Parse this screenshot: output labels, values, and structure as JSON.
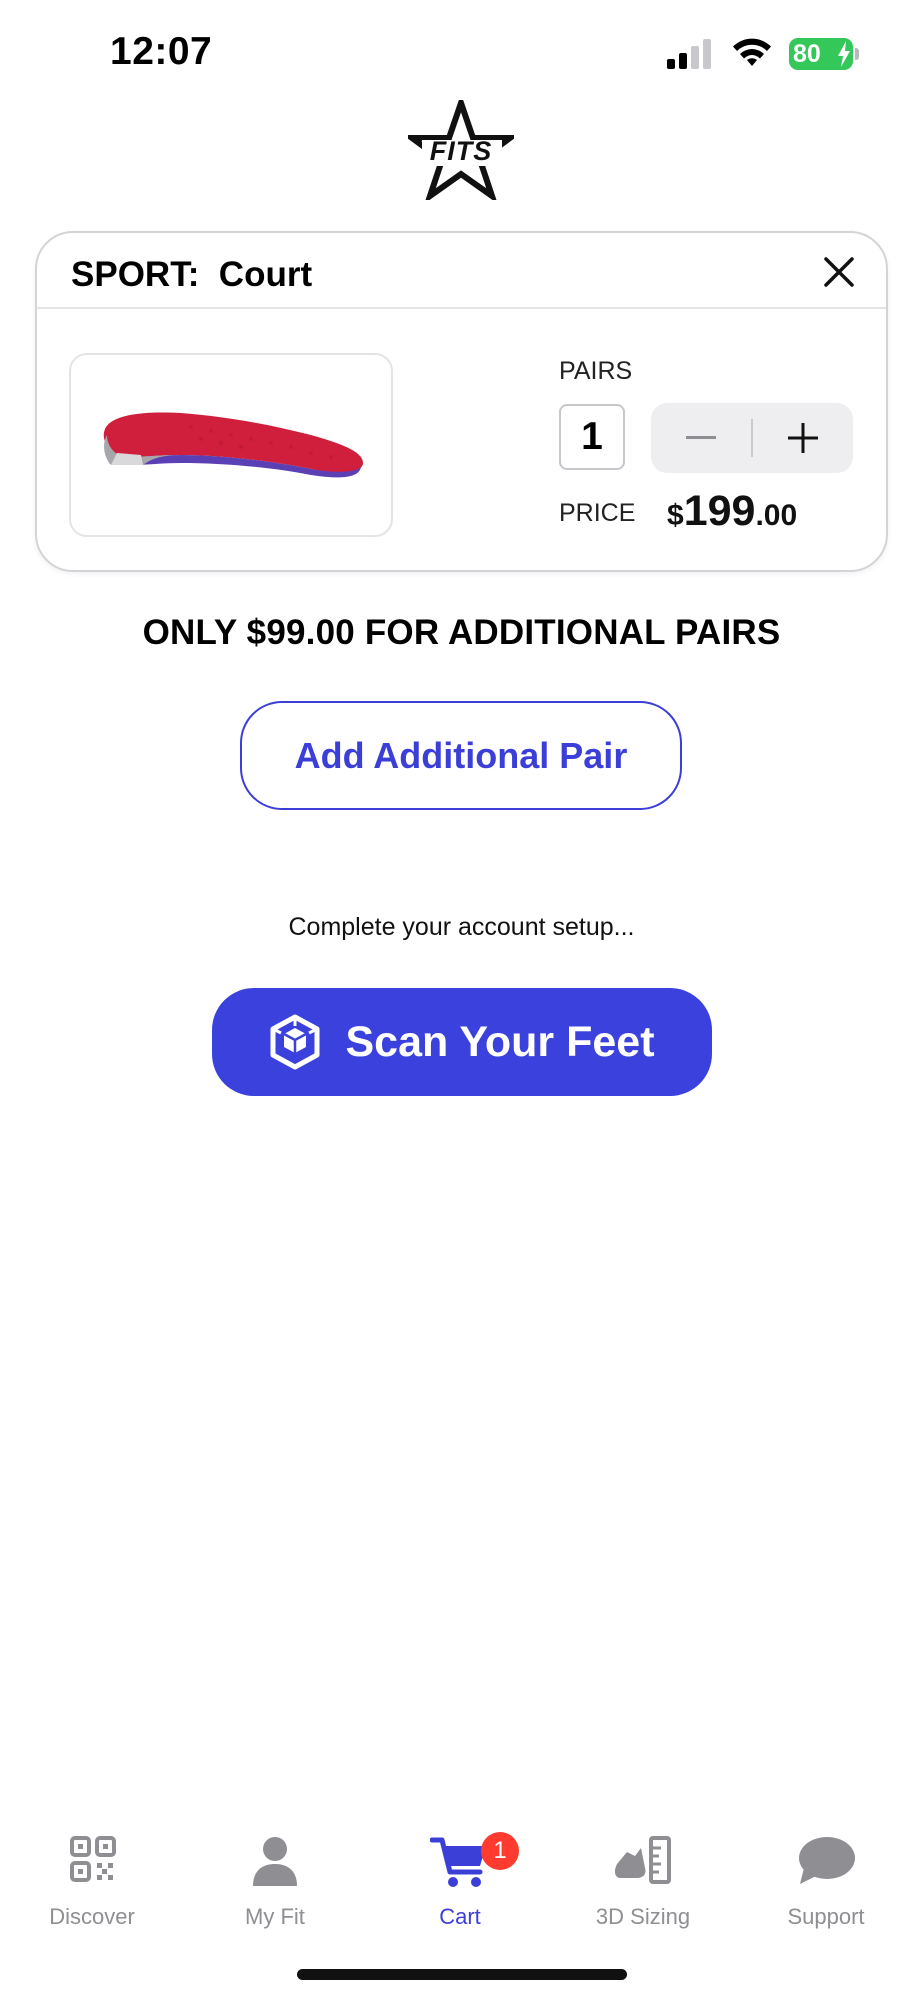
{
  "status_bar": {
    "time": "12:07",
    "battery": "80"
  },
  "brand": {
    "logo_text": "FITS"
  },
  "card": {
    "title": "SPORT:  Court",
    "pairs_label": "PAIRS",
    "quantity": "1",
    "price_label": "PRICE",
    "price_currency": "$",
    "price_whole": "199",
    "price_cents": ".00"
  },
  "promo_text": "ONLY $99.00 FOR ADDITIONAL PAIRS",
  "add_pair_label": "Add Additional Pair",
  "setup_text": "Complete your account setup...",
  "scan_label": "Scan Your Feet",
  "tabs": [
    {
      "label": "Discover",
      "icon": "qr-code-icon"
    },
    {
      "label": "My Fit",
      "icon": "person-icon"
    },
    {
      "label": "Cart",
      "icon": "cart-icon",
      "badge": "1",
      "active": true
    },
    {
      "label": "3D Sizing",
      "icon": "shoe-ruler-icon"
    },
    {
      "label": "Support",
      "icon": "chat-bubble-icon"
    }
  ],
  "colors": {
    "accent": "#3b3fd8",
    "badge": "#ff3b30",
    "battery": "#34c759",
    "inactive_tab": "#8e8e93"
  }
}
